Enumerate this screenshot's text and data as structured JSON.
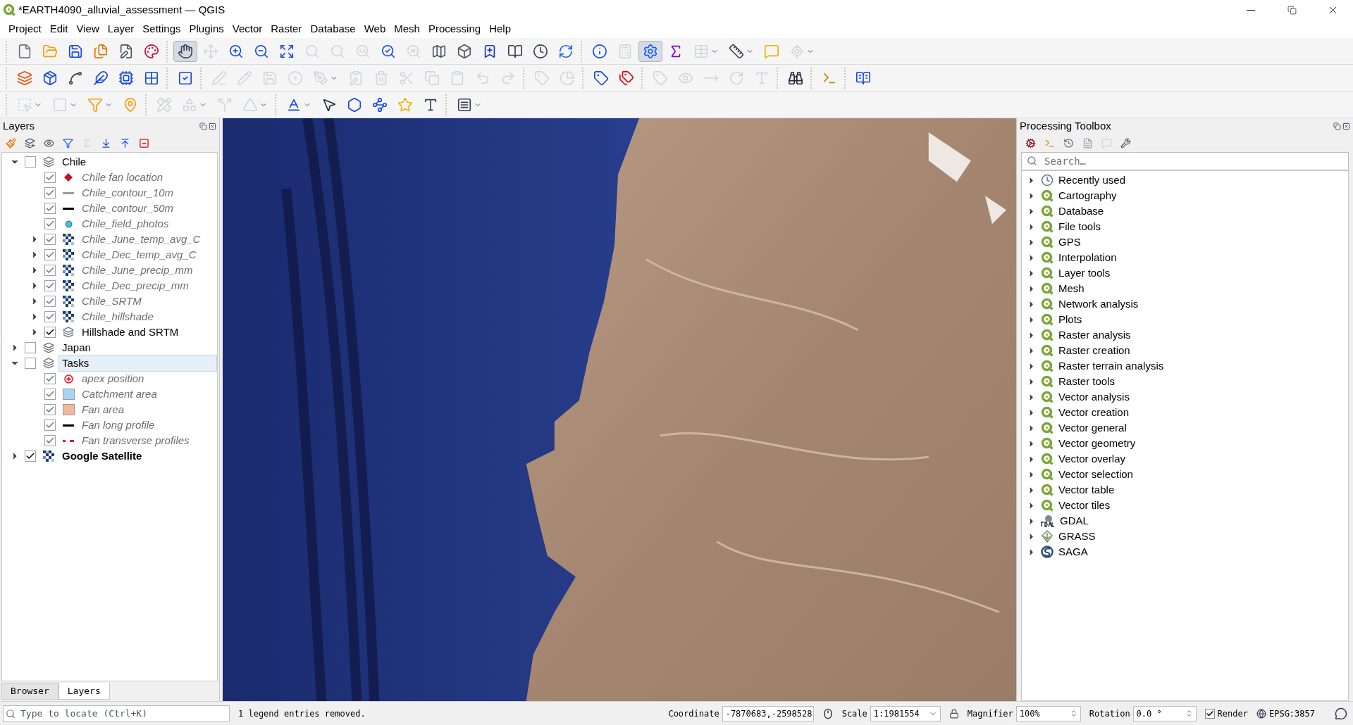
{
  "window": {
    "title": "*EARTH4090_alluvial_assessment — QGIS"
  },
  "menu": [
    "Project",
    "Edit",
    "View",
    "Layer",
    "Settings",
    "Plugins",
    "Vector",
    "Raster",
    "Database",
    "Web",
    "Mesh",
    "Processing",
    "Help"
  ],
  "toolbars": [
    {
      "groups": [
        [
          {
            "kind": "new",
            "disabled": false,
            "pressed": false
          },
          {
            "kind": "open",
            "disabled": false,
            "pressed": false
          },
          {
            "kind": "save",
            "disabled": false,
            "pressed": false
          },
          {
            "kind": "saveas",
            "disabled": false,
            "pressed": false
          },
          {
            "kind": "layout",
            "disabled": false,
            "pressed": false
          },
          {
            "kind": "style",
            "disabled": false,
            "pressed": false
          }
        ],
        [
          {
            "kind": "pan",
            "disabled": false,
            "pressed": true
          },
          {
            "kind": "panselect",
            "disabled": true,
            "pressed": false
          },
          {
            "kind": "zoomin",
            "disabled": false,
            "pressed": false
          },
          {
            "kind": "zoomout",
            "disabled": false,
            "pressed": false
          },
          {
            "kind": "zoomfull",
            "disabled": false,
            "pressed": false
          },
          {
            "kind": "zoomsel",
            "disabled": true,
            "pressed": false
          },
          {
            "kind": "zoomlayer",
            "disabled": true,
            "pressed": false
          },
          {
            "kind": "zoomnative",
            "disabled": true,
            "pressed": false
          },
          {
            "kind": "zoomlast",
            "disabled": false,
            "pressed": false
          },
          {
            "kind": "zoomnext",
            "disabled": true,
            "pressed": false
          },
          {
            "kind": "mapview",
            "disabled": false,
            "pressed": false
          },
          {
            "kind": "view3d",
            "disabled": false,
            "pressed": false
          },
          {
            "kind": "bookmark",
            "disabled": false,
            "pressed": false
          },
          {
            "kind": "bookmarks",
            "disabled": false,
            "pressed": false
          },
          {
            "kind": "temporal",
            "disabled": false,
            "pressed": false
          },
          {
            "kind": "refresh",
            "disabled": false,
            "pressed": false
          }
        ],
        [
          {
            "kind": "identify",
            "disabled": false,
            "pressed": false
          },
          {
            "kind": "actions",
            "disabled": true,
            "pressed": false
          },
          {
            "kind": "gear",
            "disabled": false,
            "pressed": true
          },
          {
            "kind": "sum",
            "disabled": false,
            "pressed": false
          },
          {
            "kind": "table",
            "disabled": true,
            "pressed": false
          },
          {
            "kind": "measure",
            "disabled": false,
            "pressed": false
          },
          {
            "kind": "tip",
            "disabled": false,
            "pressed": false
          },
          {
            "kind": "locator",
            "disabled": true,
            "pressed": false
          }
        ]
      ]
    },
    {
      "groups": [
        [
          {
            "kind": "addlayers",
            "disabled": false,
            "pressed": false
          },
          {
            "kind": "geopackage",
            "disabled": false,
            "pressed": false
          },
          {
            "kind": "newvector",
            "disabled": false,
            "pressed": false
          },
          {
            "kind": "spatialite",
            "disabled": false,
            "pressed": false
          },
          {
            "kind": "templayer",
            "disabled": false,
            "pressed": false
          },
          {
            "kind": "mesh",
            "disabled": false,
            "pressed": false
          }
        ],
        [
          {
            "kind": "virtual",
            "disabled": false,
            "pressed": false
          }
        ],
        [
          {
            "kind": "editpen",
            "disabled": true,
            "pressed": false
          },
          {
            "kind": "toggleedit",
            "disabled": true,
            "pressed": false
          },
          {
            "kind": "saveedits",
            "disabled": true,
            "pressed": false
          },
          {
            "kind": "digitize",
            "disabled": true,
            "pressed": false
          },
          {
            "kind": "vertex",
            "disabled": true,
            "pressed": false
          },
          {
            "kind": "attrs",
            "disabled": true,
            "pressed": false
          },
          {
            "kind": "delete",
            "disabled": true,
            "pressed": false
          },
          {
            "kind": "cut",
            "disabled": true,
            "pressed": false
          },
          {
            "kind": "copy",
            "disabled": true,
            "pressed": false
          },
          {
            "kind": "paste",
            "disabled": true,
            "pressed": false
          },
          {
            "kind": "undo",
            "disabled": true,
            "pressed": false
          },
          {
            "kind": "redo",
            "disabled": true,
            "pressed": false
          }
        ],
        [
          {
            "kind": "labelpin",
            "disabled": true,
            "pressed": false
          },
          {
            "kind": "labeldiagram",
            "disabled": true,
            "pressed": false
          }
        ],
        [
          {
            "kind": "labeltool",
            "disabled": false,
            "pressed": false
          },
          {
            "kind": "labelabc",
            "disabled": false,
            "pressed": false
          }
        ],
        [
          {
            "kind": "labelpin",
            "disabled": true,
            "pressed": false
          },
          {
            "kind": "labelshow",
            "disabled": true,
            "pressed": false
          },
          {
            "kind": "labelmove",
            "disabled": true,
            "pressed": false
          },
          {
            "kind": "labelrotate",
            "disabled": true,
            "pressed": false
          },
          {
            "kind": "labelchange",
            "disabled": true,
            "pressed": false
          }
        ],
        [
          {
            "kind": "metasearch",
            "disabled": false,
            "pressed": false
          }
        ],
        [
          {
            "kind": "python",
            "disabled": false,
            "pressed": false
          }
        ],
        [
          {
            "kind": "help",
            "disabled": false,
            "pressed": false
          }
        ]
      ]
    },
    {
      "groups": [
        [
          {
            "kind": "select",
            "disabled": true,
            "pressed": false
          },
          {
            "kind": "deselect",
            "disabled": true,
            "pressed": false
          },
          {
            "kind": "selectexpr",
            "disabled": false,
            "pressed": false
          },
          {
            "kind": "selectloc",
            "disabled": false,
            "pressed": false
          }
        ],
        [
          {
            "kind": "advdigitize",
            "disabled": true,
            "pressed": false
          },
          {
            "kind": "reshape",
            "disabled": true,
            "pressed": false
          },
          {
            "kind": "split",
            "disabled": true,
            "pressed": false
          },
          {
            "kind": "offset",
            "disabled": true,
            "pressed": false
          }
        ],
        [
          {
            "kind": "labelfont",
            "disabled": false,
            "pressed": false
          },
          {
            "kind": "pointer",
            "disabled": false,
            "pressed": false
          },
          {
            "kind": "addpolygon",
            "disabled": false,
            "pressed": false
          },
          {
            "kind": "addline",
            "disabled": false,
            "pressed": false
          },
          {
            "kind": "addmarker",
            "disabled": false,
            "pressed": false
          },
          {
            "kind": "addtext",
            "disabled": false,
            "pressed": false
          }
        ],
        [
          {
            "kind": "annotation",
            "disabled": false,
            "pressed": false
          }
        ]
      ]
    }
  ],
  "layers_panel": {
    "title": "Layers",
    "tree": [
      {
        "label": "Chile",
        "kind": "group",
        "checked": false,
        "expanded": true,
        "dimmed": false,
        "bold": false,
        "selected": false,
        "children": [
          {
            "label": "Chile fan location",
            "kind": "diamond",
            "color": "#c8101e",
            "checked": true,
            "dimmed": true,
            "bold": false,
            "selected": false
          },
          {
            "label": "Chile_contour_10m",
            "kind": "line",
            "color": "#9a9a9a",
            "checked": true,
            "dimmed": true,
            "bold": false,
            "selected": false
          },
          {
            "label": "Chile_contour_50m",
            "kind": "line",
            "color": "#000000",
            "checked": true,
            "dimmed": true,
            "bold": false,
            "selected": false
          },
          {
            "label": "Chile_field_photos",
            "kind": "circle",
            "color": "#3cc0e0",
            "checked": true,
            "dimmed": true,
            "bold": false,
            "selected": false
          },
          {
            "label": "Chile_June_temp_avg_C",
            "kind": "raster",
            "checked": true,
            "expanded": false,
            "dimmed": true,
            "bold": false,
            "selected": false
          },
          {
            "label": "Chile_Dec_temp_avg_C",
            "kind": "raster",
            "checked": true,
            "expanded": false,
            "dimmed": true,
            "bold": false,
            "selected": false
          },
          {
            "label": "Chile_June_precip_mm",
            "kind": "raster",
            "checked": true,
            "expanded": false,
            "dimmed": true,
            "bold": false,
            "selected": false
          },
          {
            "label": "Chile_Dec_precip_mm",
            "kind": "raster",
            "checked": true,
            "expanded": false,
            "dimmed": true,
            "bold": false,
            "selected": false
          },
          {
            "label": "Chile_SRTM",
            "kind": "raster",
            "checked": true,
            "expanded": false,
            "dimmed": true,
            "bold": false,
            "selected": false
          },
          {
            "label": "Chile_hillshade",
            "kind": "raster",
            "checked": true,
            "expanded": false,
            "dimmed": true,
            "bold": false,
            "selected": false
          },
          {
            "label": "Hillshade and SRTM",
            "kind": "group",
            "checked": true,
            "expanded": false,
            "dimmed": false,
            "bold": false,
            "selected": false
          }
        ]
      },
      {
        "label": "Japan",
        "kind": "group",
        "checked": false,
        "expanded": false,
        "dimmed": false,
        "bold": false,
        "selected": false
      },
      {
        "label": "Tasks",
        "kind": "group",
        "checked": false,
        "expanded": true,
        "dimmed": false,
        "bold": false,
        "selected": true,
        "children": [
          {
            "label": "apex position",
            "kind": "target",
            "color": "#e0182c",
            "checked": true,
            "dimmed": true,
            "bold": false,
            "selected": false
          },
          {
            "label": "Catchment area",
            "kind": "fill",
            "color": "#a6d4f2",
            "checked": true,
            "dimmed": true,
            "bold": false,
            "selected": false
          },
          {
            "label": "Fan area",
            "kind": "fill",
            "color": "#f2b89c",
            "checked": true,
            "dimmed": true,
            "bold": false,
            "selected": false
          },
          {
            "label": "Fan long profile",
            "kind": "line",
            "color": "#000000",
            "checked": true,
            "dimmed": true,
            "bold": false,
            "selected": false
          },
          {
            "label": "Fan transverse profiles",
            "kind": "dashed",
            "color": "#e0182c",
            "checked": true,
            "dimmed": true,
            "bold": false,
            "selected": false
          }
        ]
      },
      {
        "label": "Google Satellite",
        "kind": "raster",
        "checked": true,
        "expanded": false,
        "dimmed": false,
        "bold": true,
        "selected": false
      }
    ],
    "tabs": [
      {
        "label": "Browser",
        "selected": false
      },
      {
        "label": "Layers",
        "selected": true
      }
    ]
  },
  "processing_toolbox": {
    "title": "Processing Toolbox",
    "search": {
      "placeholder": "Search…"
    },
    "items": [
      {
        "label": "Recently used",
        "kind": "recent",
        "expanded": false
      },
      {
        "label": "Cartography",
        "kind": "qgis",
        "expanded": false
      },
      {
        "label": "Database",
        "kind": "qgis",
        "expanded": false
      },
      {
        "label": "File tools",
        "kind": "qgis",
        "expanded": false
      },
      {
        "label": "GPS",
        "kind": "qgis",
        "expanded": false
      },
      {
        "label": "Interpolation",
        "kind": "qgis",
        "expanded": false
      },
      {
        "label": "Layer tools",
        "kind": "qgis",
        "expanded": false
      },
      {
        "label": "Mesh",
        "kind": "qgis",
        "expanded": false
      },
      {
        "label": "Network analysis",
        "kind": "qgis",
        "expanded": false
      },
      {
        "label": "Plots",
        "kind": "qgis",
        "expanded": false
      },
      {
        "label": "Raster analysis",
        "kind": "qgis",
        "expanded": false
      },
      {
        "label": "Raster creation",
        "kind": "qgis",
        "expanded": false
      },
      {
        "label": "Raster terrain analysis",
        "kind": "qgis",
        "expanded": false
      },
      {
        "label": "Raster tools",
        "kind": "qgis",
        "expanded": false
      },
      {
        "label": "Vector analysis",
        "kind": "qgis",
        "expanded": false
      },
      {
        "label": "Vector creation",
        "kind": "qgis",
        "expanded": false
      },
      {
        "label": "Vector general",
        "kind": "qgis",
        "expanded": false
      },
      {
        "label": "Vector geometry",
        "kind": "qgis",
        "expanded": false
      },
      {
        "label": "Vector overlay",
        "kind": "qgis",
        "expanded": false
      },
      {
        "label": "Vector selection",
        "kind": "qgis",
        "expanded": false
      },
      {
        "label": "Vector table",
        "kind": "qgis",
        "expanded": false
      },
      {
        "label": "Vector tiles",
        "kind": "qgis",
        "expanded": false
      },
      {
        "label": "GDAL",
        "kind": "gdal",
        "expanded": false
      },
      {
        "label": "GRASS",
        "kind": "grass",
        "expanded": false
      },
      {
        "label": "SAGA",
        "kind": "saga",
        "expanded": false
      }
    ]
  },
  "status_bar": {
    "locator": {
      "placeholder": "Type to locate (Ctrl+K)"
    },
    "message": "1 legend entries removed.",
    "coordinate": {
      "label": "Coordinate",
      "value": "-7870683,-2598528"
    },
    "scale": {
      "label": "Scale",
      "value": "1:1981554"
    },
    "magnifier": {
      "label": "Magnifier",
      "value": "100%"
    },
    "rotation": {
      "label": "Rotation",
      "value": "0.0 °"
    },
    "render": {
      "label": "Render",
      "checked": true
    },
    "crs": "EPSG:3857"
  }
}
